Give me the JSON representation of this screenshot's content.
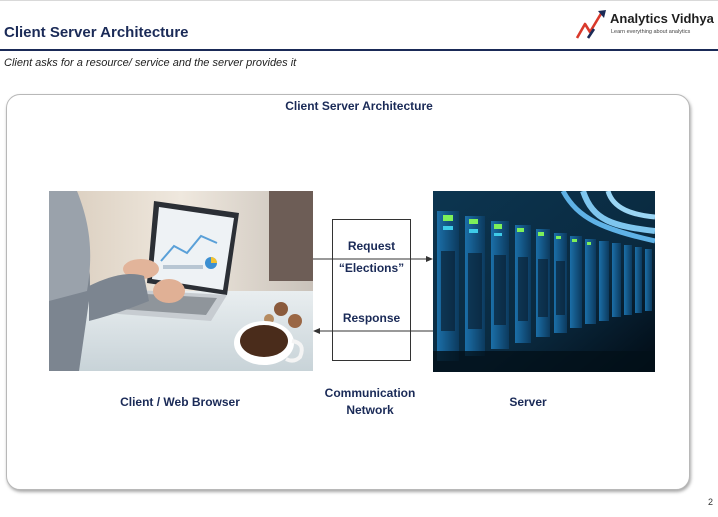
{
  "slide": {
    "title": "Client Server Architecture",
    "subtitle": "Client asks for a resource/ service and the server provides it",
    "page_number": "2"
  },
  "logo": {
    "name": "Analytics Vidhya",
    "tagline": "Learn everything about analytics"
  },
  "diagram": {
    "title": "Client Server Architecture",
    "client_label": "Client / Web Browser",
    "server_label": "Server",
    "network_label_line1": "Communication",
    "network_label_line2": "Network",
    "request_label": "Request",
    "request_example": "“Elections”",
    "response_label": "Response"
  },
  "colors": {
    "navy": "#1a2a57",
    "logo_red": "#d9392b",
    "server_blue": "#1e8fd6",
    "server_led_green": "#7df05a"
  }
}
